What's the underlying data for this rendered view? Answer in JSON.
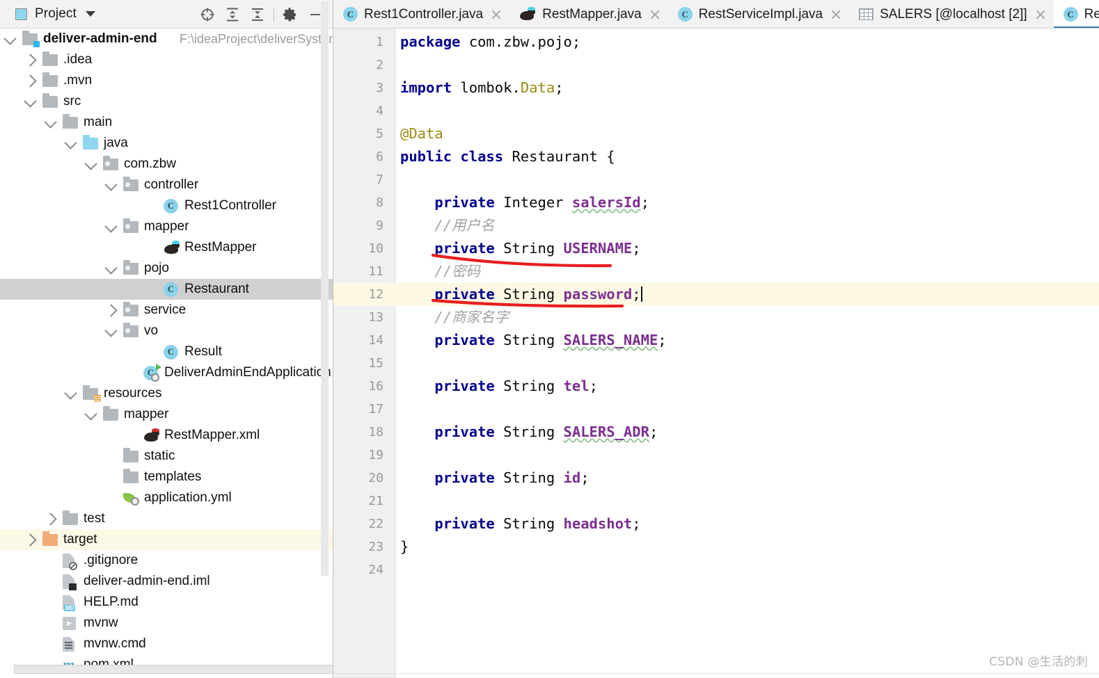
{
  "panel": {
    "title": "Project",
    "icons": [
      {
        "name": "locate-target-icon",
        "glyph": "crosshair"
      },
      {
        "name": "expand-all-icon",
        "glyph": "expand"
      },
      {
        "name": "collapse-all-icon",
        "glyph": "collapse"
      },
      {
        "name": "settings-gear-icon",
        "glyph": "gear"
      },
      {
        "name": "hide-panel-icon",
        "glyph": "minus"
      }
    ]
  },
  "tree": {
    "root": {
      "label": "deliver-admin-end",
      "path": "F:\\ideaProject\\deliverSystem"
    },
    "nodes": [
      {
        "label": ".idea",
        "indent": 1,
        "arrow": "right",
        "icon": "folder"
      },
      {
        "label": ".mvn",
        "indent": 1,
        "arrow": "right",
        "icon": "folder"
      },
      {
        "label": "src",
        "indent": 1,
        "arrow": "down",
        "icon": "folder"
      },
      {
        "label": "main",
        "indent": 2,
        "arrow": "down",
        "icon": "folder"
      },
      {
        "label": "java",
        "indent": 3,
        "arrow": "down",
        "icon": "folder-source"
      },
      {
        "label": "com.zbw",
        "indent": 4,
        "arrow": "down",
        "icon": "folder-package"
      },
      {
        "label": "controller",
        "indent": 5,
        "arrow": "down",
        "icon": "folder-package"
      },
      {
        "label": "Rest1Controller",
        "indent": 7,
        "arrow": "none",
        "icon": "java-class"
      },
      {
        "label": "mapper",
        "indent": 5,
        "arrow": "down",
        "icon": "folder-package"
      },
      {
        "label": "RestMapper",
        "indent": 7,
        "arrow": "none",
        "icon": "mybatis-mapper"
      },
      {
        "label": "pojo",
        "indent": 5,
        "arrow": "down",
        "icon": "folder-package"
      },
      {
        "label": "Restaurant",
        "indent": 7,
        "arrow": "none",
        "icon": "java-class",
        "state": "selected"
      },
      {
        "label": "service",
        "indent": 5,
        "arrow": "right",
        "icon": "folder-package"
      },
      {
        "label": "vo",
        "indent": 5,
        "arrow": "down",
        "icon": "folder-package"
      },
      {
        "label": "Result",
        "indent": 7,
        "arrow": "none",
        "icon": "java-class"
      },
      {
        "label": "DeliverAdminEndApplication",
        "indent": 6,
        "arrow": "none",
        "icon": "java-class-run"
      },
      {
        "label": "resources",
        "indent": 3,
        "arrow": "down",
        "icon": "folder-resources"
      },
      {
        "label": "mapper",
        "indent": 4,
        "arrow": "down",
        "icon": "folder"
      },
      {
        "label": "RestMapper.xml",
        "indent": 6,
        "arrow": "none",
        "icon": "mybatis-xml"
      },
      {
        "label": "static",
        "indent": 5,
        "arrow": "none",
        "icon": "folder"
      },
      {
        "label": "templates",
        "indent": 5,
        "arrow": "none",
        "icon": "folder"
      },
      {
        "label": "application.yml",
        "indent": 5,
        "arrow": "none",
        "icon": "spring-yml"
      },
      {
        "label": "test",
        "indent": 2,
        "arrow": "right",
        "icon": "folder"
      },
      {
        "label": "target",
        "indent": 1,
        "arrow": "right",
        "icon": "folder-target",
        "state": "amber"
      },
      {
        "label": ".gitignore",
        "indent": 2,
        "arrow": "none",
        "icon": "gitignore-file"
      },
      {
        "label": "deliver-admin-end.iml",
        "indent": 2,
        "arrow": "none",
        "icon": "iml-file"
      },
      {
        "label": "HELP.md",
        "indent": 2,
        "arrow": "none",
        "icon": "markdown-file"
      },
      {
        "label": "mvnw",
        "indent": 2,
        "arrow": "none",
        "icon": "script-file"
      },
      {
        "label": "mvnw.cmd",
        "indent": 2,
        "arrow": "none",
        "icon": "cmd-file"
      },
      {
        "label": "pom.xml",
        "indent": 2,
        "arrow": "none",
        "icon": "maven-file"
      }
    ]
  },
  "tabs": [
    {
      "label": "Rest1Controller.java",
      "icon": "java-class",
      "active": false,
      "closable": true
    },
    {
      "label": "RestMapper.java",
      "icon": "mybatis-mapper",
      "active": false,
      "closable": true
    },
    {
      "label": "RestServiceImpl.java",
      "icon": "java-class",
      "active": false,
      "closable": true
    },
    {
      "label": "SALERS [@localhost [2]]",
      "icon": "db-table",
      "active": false,
      "closable": true
    },
    {
      "label": "Restaurant.java",
      "icon": "java-class",
      "active": true,
      "closable": false
    }
  ],
  "editor": {
    "current_line": 12,
    "lines": [
      {
        "n": 1,
        "tokens": [
          {
            "t": "package ",
            "c": "kw"
          },
          {
            "t": "com.zbw.pojo;",
            "c": "type"
          }
        ]
      },
      {
        "n": 2,
        "tokens": []
      },
      {
        "n": 3,
        "tokens": [
          {
            "t": "import ",
            "c": "kw"
          },
          {
            "t": "lombok.",
            "c": "type"
          },
          {
            "t": "Data",
            "c": "lit"
          },
          {
            "t": ";",
            "c": "type"
          }
        ]
      },
      {
        "n": 4,
        "tokens": []
      },
      {
        "n": 5,
        "tokens": [
          {
            "t": "@Data",
            "c": "ann"
          }
        ]
      },
      {
        "n": 6,
        "tokens": [
          {
            "t": "public class ",
            "c": "kw"
          },
          {
            "t": "Restaurant {",
            "c": "type"
          }
        ]
      },
      {
        "n": 7,
        "tokens": []
      },
      {
        "n": 8,
        "tokens": [
          {
            "t": "    ",
            "c": "type"
          },
          {
            "t": "private ",
            "c": "kw"
          },
          {
            "t": "Integer ",
            "c": "type"
          },
          {
            "t": "salersId",
            "c": "fld-u"
          },
          {
            "t": ";",
            "c": "type"
          }
        ]
      },
      {
        "n": 9,
        "tokens": [
          {
            "t": "    //用户名",
            "c": "cmt"
          }
        ]
      },
      {
        "n": 10,
        "tokens": [
          {
            "t": "    ",
            "c": "type"
          },
          {
            "t": "private ",
            "c": "kw"
          },
          {
            "t": "String ",
            "c": "type"
          },
          {
            "t": "USERNAME",
            "c": "fld"
          },
          {
            "t": ";",
            "c": "type"
          }
        ]
      },
      {
        "n": 11,
        "tokens": [
          {
            "t": "    //密码",
            "c": "cmt"
          }
        ]
      },
      {
        "n": 12,
        "tokens": [
          {
            "t": "    ",
            "c": "type"
          },
          {
            "t": "private ",
            "c": "kw"
          },
          {
            "t": "String ",
            "c": "type"
          },
          {
            "t": "password",
            "c": "fld"
          },
          {
            "t": ";",
            "c": "type"
          }
        ]
      },
      {
        "n": 13,
        "tokens": [
          {
            "t": "    //商家名字",
            "c": "cmt"
          }
        ]
      },
      {
        "n": 14,
        "tokens": [
          {
            "t": "    ",
            "c": "type"
          },
          {
            "t": "private ",
            "c": "kw"
          },
          {
            "t": "String ",
            "c": "type"
          },
          {
            "t": "SALERS_NAME",
            "c": "fld-u"
          },
          {
            "t": ";",
            "c": "type"
          }
        ]
      },
      {
        "n": 15,
        "tokens": []
      },
      {
        "n": 16,
        "tokens": [
          {
            "t": "    ",
            "c": "type"
          },
          {
            "t": "private ",
            "c": "kw"
          },
          {
            "t": "String ",
            "c": "type"
          },
          {
            "t": "tel",
            "c": "fld"
          },
          {
            "t": ";",
            "c": "type"
          }
        ]
      },
      {
        "n": 17,
        "tokens": []
      },
      {
        "n": 18,
        "tokens": [
          {
            "t": "    ",
            "c": "type"
          },
          {
            "t": "private ",
            "c": "kw"
          },
          {
            "t": "String ",
            "c": "type"
          },
          {
            "t": "SALERS_ADR",
            "c": "fld-u"
          },
          {
            "t": ";",
            "c": "type"
          }
        ]
      },
      {
        "n": 19,
        "tokens": []
      },
      {
        "n": 20,
        "tokens": [
          {
            "t": "    ",
            "c": "type"
          },
          {
            "t": "private ",
            "c": "kw"
          },
          {
            "t": "String ",
            "c": "type"
          },
          {
            "t": "id",
            "c": "fld"
          },
          {
            "t": ";",
            "c": "type"
          }
        ]
      },
      {
        "n": 21,
        "tokens": []
      },
      {
        "n": 22,
        "tokens": [
          {
            "t": "    ",
            "c": "type"
          },
          {
            "t": "private ",
            "c": "kw"
          },
          {
            "t": "String ",
            "c": "type"
          },
          {
            "t": "headshot",
            "c": "fld"
          },
          {
            "t": ";",
            "c": "type"
          }
        ]
      },
      {
        "n": 23,
        "tokens": [
          {
            "t": "}",
            "c": "type"
          }
        ]
      },
      {
        "n": 24,
        "tokens": []
      }
    ]
  },
  "annotations": {
    "color": "#e81e1e",
    "marks": [
      {
        "name": "red-underline-username",
        "line": 10
      },
      {
        "name": "red-underline-password",
        "line": 12
      }
    ]
  },
  "watermark": "CSDN @生活的刺",
  "colors": {
    "accent": "#3b7ebf",
    "selection": "#d0d0d0",
    "current_line": "#fdf8e4",
    "keyword": "#00008f",
    "field": "#7c2f8f",
    "annotation": "#9a8a12",
    "comment": "#a3a3a3",
    "red_mark": "#e81e1e"
  }
}
